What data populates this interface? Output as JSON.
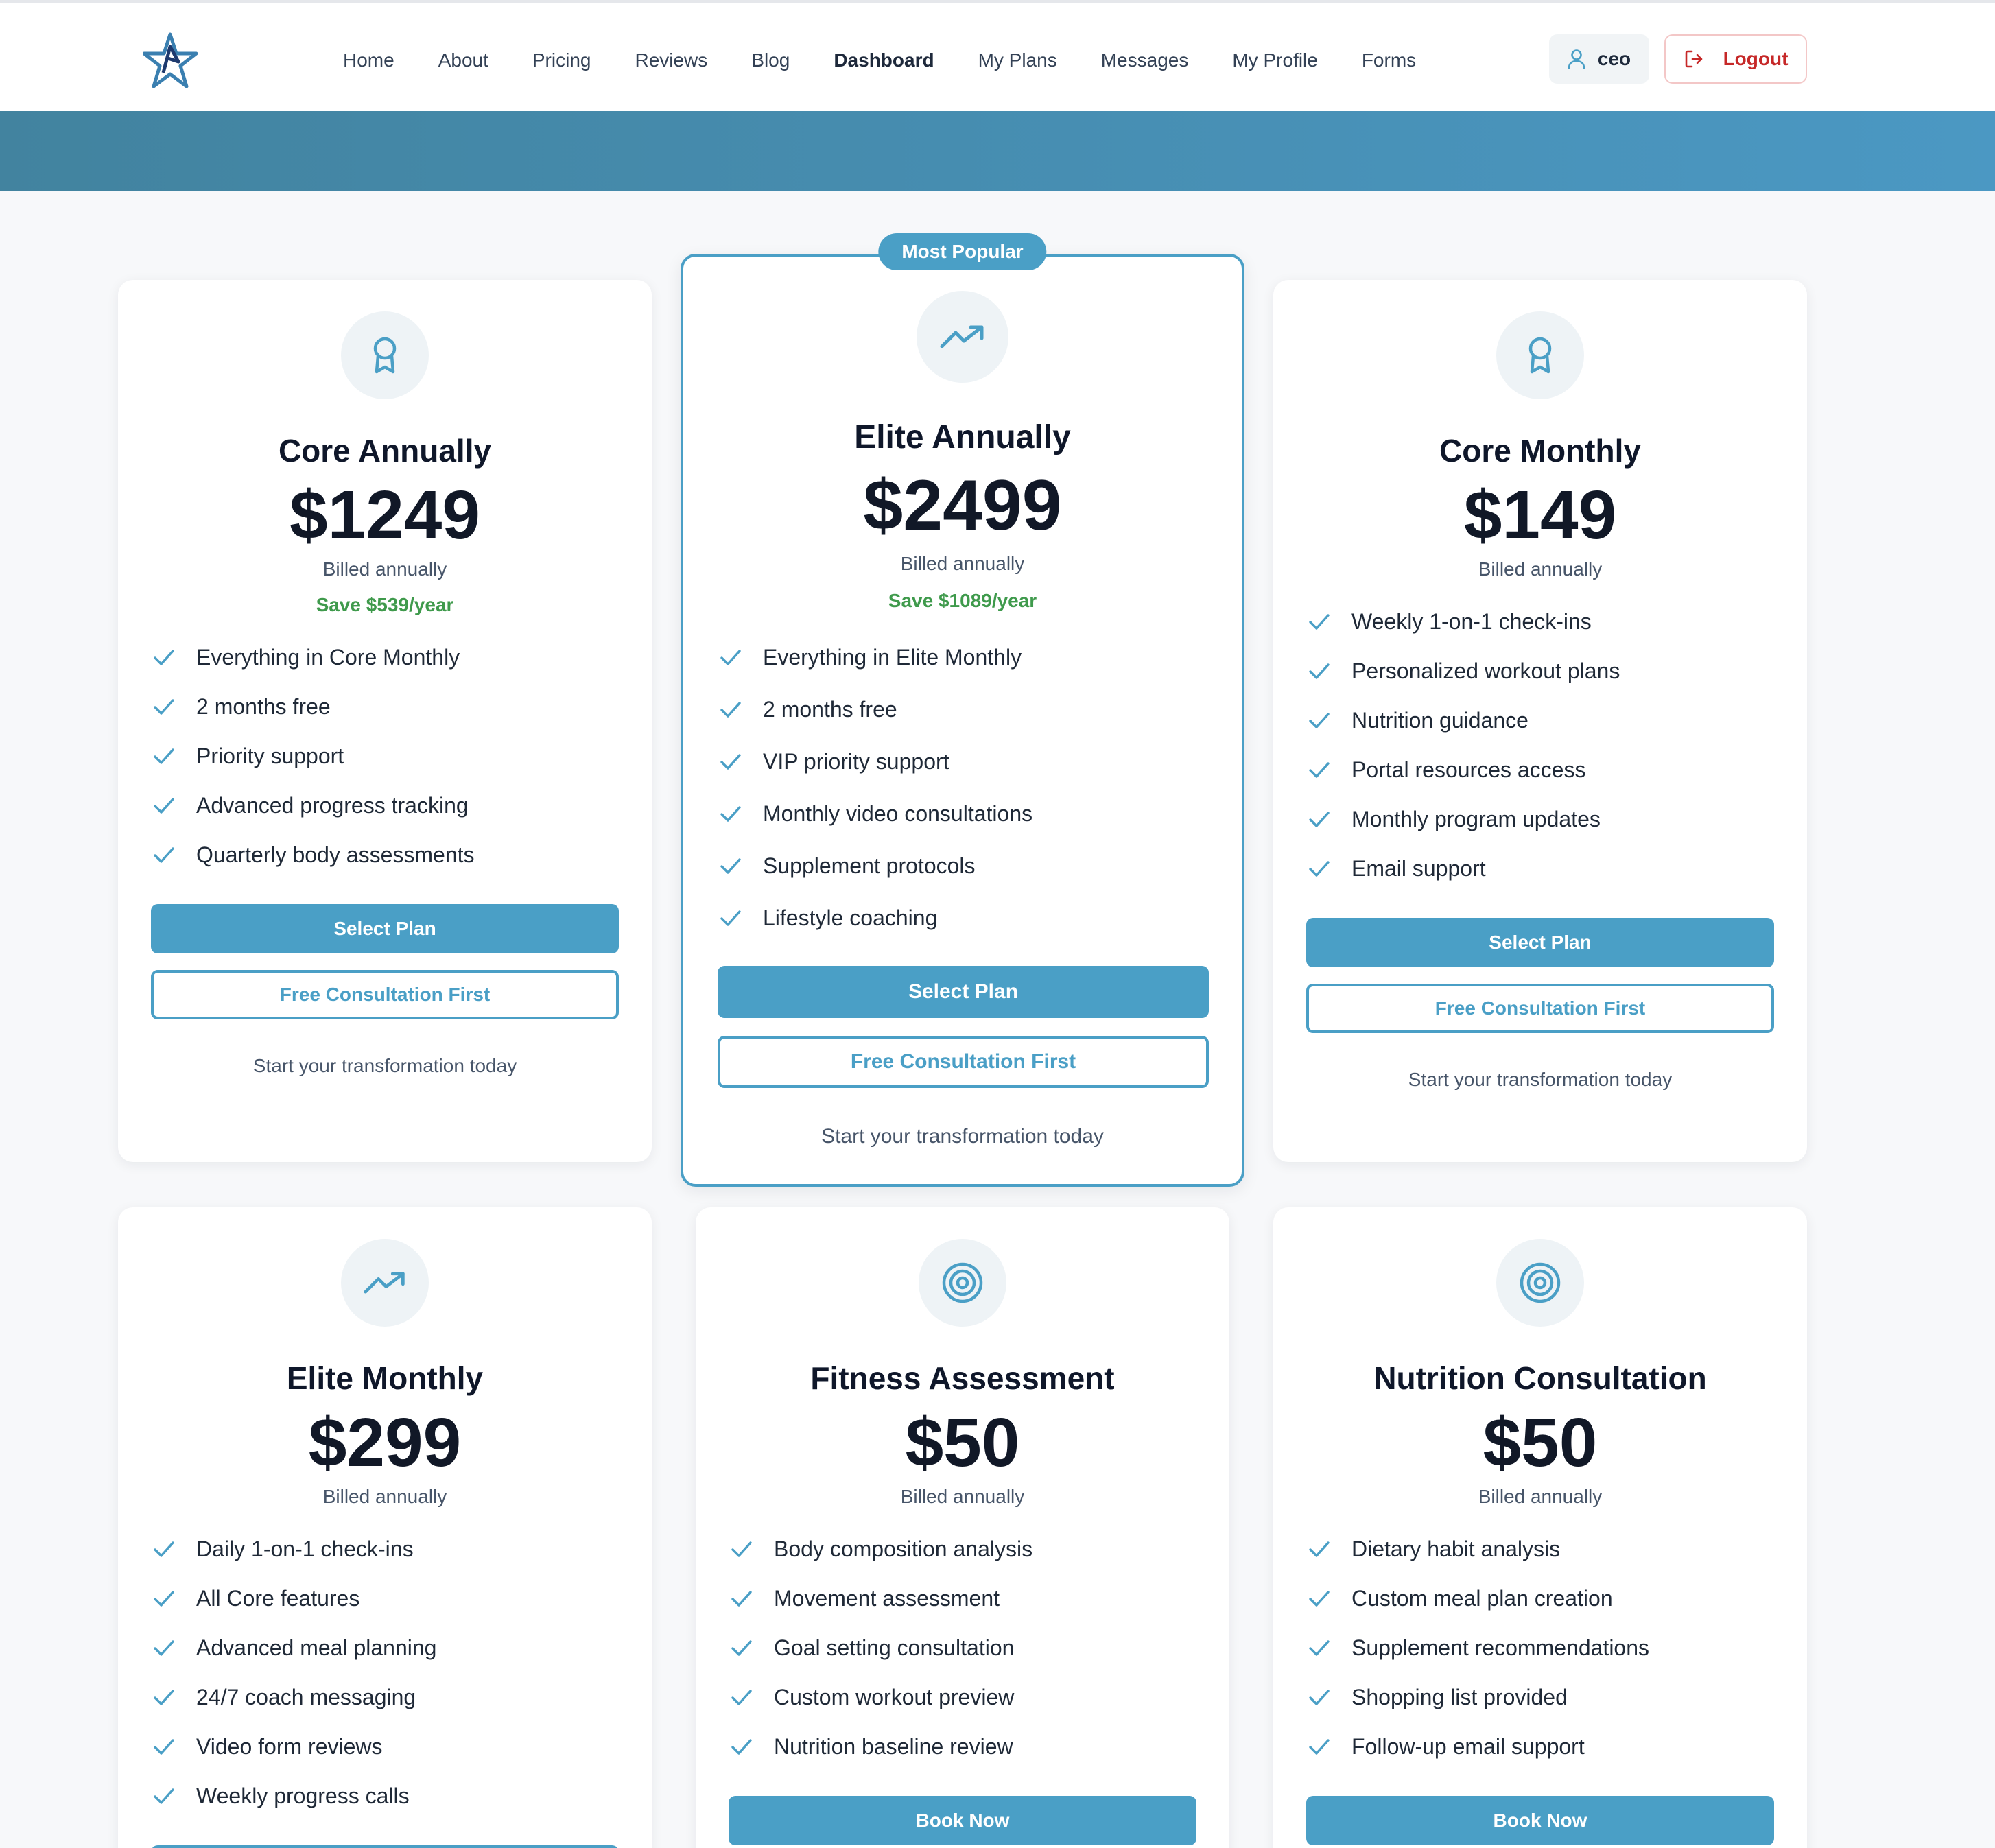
{
  "colors": {
    "brand": "#4a9fc6",
    "banner_start": "#42839f",
    "banner_end": "#4b98c3",
    "save_green": "#3f9a4c",
    "logout_red": "#c62828"
  },
  "nav": {
    "logo_icon": "star-logo-icon",
    "links": [
      "Home",
      "About",
      "Pricing",
      "Reviews",
      "Blog",
      "Dashboard",
      "My Plans",
      "Messages",
      "My Profile",
      "Forms"
    ],
    "active_link": "Dashboard",
    "user": {
      "icon": "user-icon",
      "name": "ceo"
    },
    "logout": {
      "icon": "logout-icon",
      "label": "Logout"
    }
  },
  "plans": [
    {
      "icon": "award-icon",
      "name": "Core Annually",
      "price": "$1249",
      "billing": "Billed annually",
      "save": "Save $539/year",
      "features": [
        "Everything in Core Monthly",
        "2 months free",
        "Priority support",
        "Advanced progress tracking",
        "Quarterly body assessments"
      ],
      "primary_label": "Select Plan",
      "secondary_label": "Free Consultation First",
      "tagline": "Start your transformation today"
    },
    {
      "badge": "Most Popular",
      "icon": "trending-up-icon",
      "name": "Elite Annually",
      "price": "$2499",
      "billing": "Billed annually",
      "save": "Save $1089/year",
      "features": [
        "Everything in Elite Monthly",
        "2 months free",
        "VIP priority support",
        "Monthly video consultations",
        "Supplement protocols",
        "Lifestyle coaching"
      ],
      "primary_label": "Select Plan",
      "secondary_label": "Free Consultation First",
      "tagline": "Start your transformation today"
    },
    {
      "icon": "award-icon",
      "name": "Core Monthly",
      "price": "$149",
      "billing": "Billed annually",
      "features": [
        "Weekly 1-on-1 check-ins",
        "Personalized workout plans",
        "Nutrition guidance",
        "Portal resources access",
        "Monthly program updates",
        "Email support"
      ],
      "primary_label": "Select Plan",
      "secondary_label": "Free Consultation First",
      "tagline": "Start your transformation today"
    },
    {
      "icon": "trending-up-icon",
      "name": "Elite Monthly",
      "price": "$299",
      "billing": "Billed annually",
      "features": [
        "Daily 1-on-1 check-ins",
        "All Core features",
        "Advanced meal planning",
        "24/7 coach messaging",
        "Video form reviews",
        "Weekly progress calls"
      ]
    },
    {
      "icon": "target-icon",
      "name": "Fitness Assessment",
      "price": "$50",
      "billing": "Billed annually",
      "features": [
        "Body composition analysis",
        "Movement assessment",
        "Goal setting consultation",
        "Custom workout preview",
        "Nutrition baseline review"
      ],
      "primary_label": "Book Now"
    },
    {
      "icon": "target-icon",
      "name": "Nutrition Consultation",
      "price": "$50",
      "billing": "Billed annually",
      "features": [
        "Dietary habit analysis",
        "Custom meal plan creation",
        "Supplement recommendations",
        "Shopping list provided",
        "Follow-up email support"
      ],
      "primary_label": "Book Now"
    }
  ]
}
